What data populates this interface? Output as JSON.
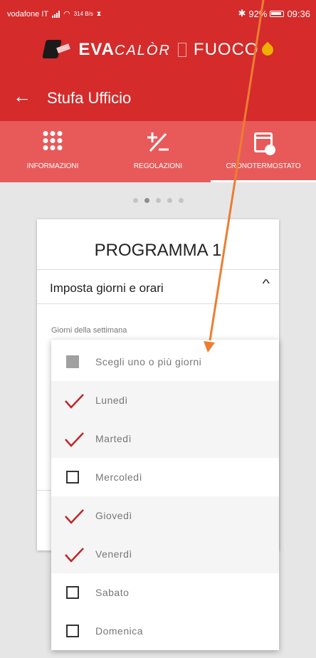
{
  "status_bar": {
    "carrier": "vodafone IT",
    "network_speed": "314 B/s",
    "bluetooth_icon": "bluetooth-icon",
    "battery": "92%",
    "time": "09:36"
  },
  "brand": {
    "logo_left_a": "EVA",
    "logo_left_b": "CALÒR",
    "logo_right": "FUOCO"
  },
  "header": {
    "back_icon": "arrow-left-icon",
    "title": "Stufa Ufficio"
  },
  "tabs": [
    {
      "label": "INFORMAZIONI",
      "icon": "grid-dots-icon",
      "active": false
    },
    {
      "label": "REGOLAZIONI",
      "icon": "plus-minus-icon",
      "active": false
    },
    {
      "label": "CRONOTERMOSTATO",
      "icon": "calendar-clock-icon",
      "active": true
    }
  ],
  "pager": {
    "count": 5,
    "active_index": 1
  },
  "card": {
    "title": "PROGRAMMA 1",
    "section_label": "Imposta giorni e orari",
    "field_label": "Giorni della settimana"
  },
  "dropdown": {
    "placeholder": "Scegli uno o più giorni",
    "options": [
      {
        "label": "Lunedì",
        "selected": true
      },
      {
        "label": "Martedì",
        "selected": true
      },
      {
        "label": "Mercoledì",
        "selected": false
      },
      {
        "label": "Giovedì",
        "selected": true
      },
      {
        "label": "Venerdì",
        "selected": true
      },
      {
        "label": "Sabato",
        "selected": false
      },
      {
        "label": "Domenica",
        "selected": false
      }
    ]
  },
  "colors": {
    "primary": "#d52b2b",
    "tab_bar": "#e85a5a",
    "check": "#c0272d",
    "annotation_arrow": "#ed7d31"
  }
}
